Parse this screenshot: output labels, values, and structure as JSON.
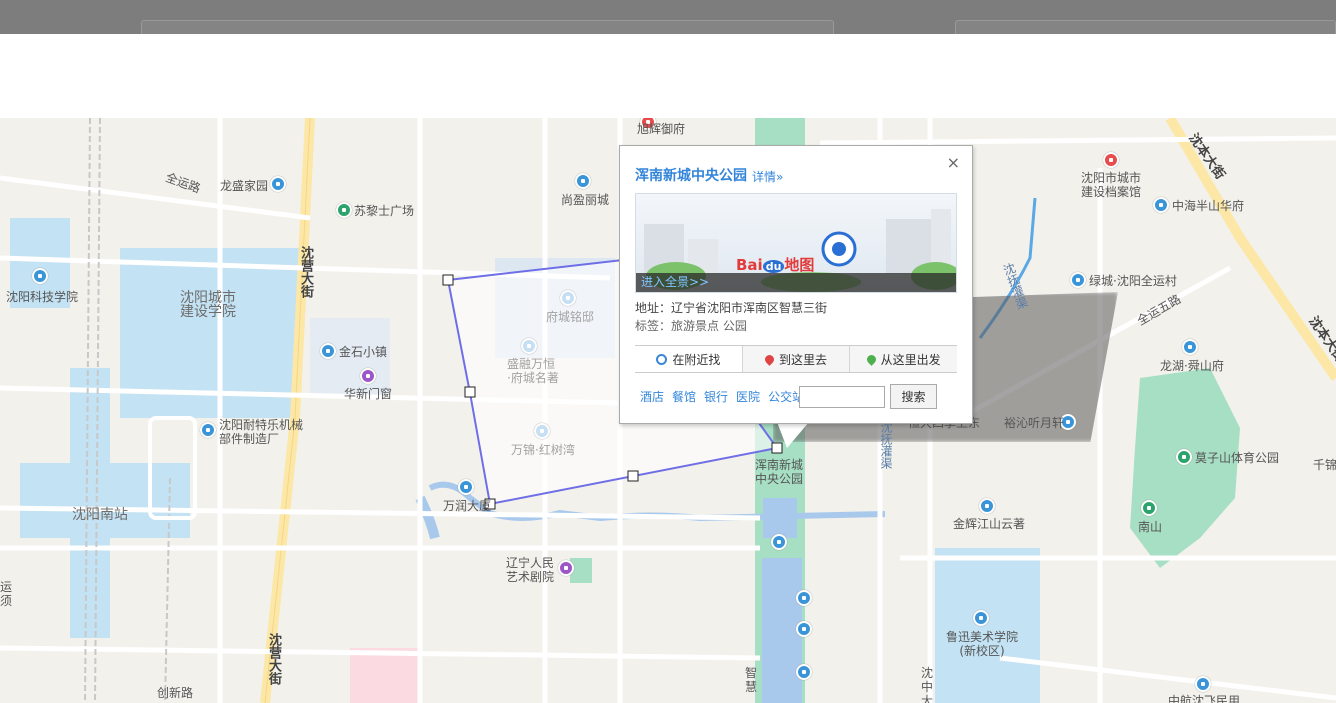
{
  "map": {
    "labels": {
      "quanyun": "全运路",
      "longsheng": "龙盛家园",
      "suli": "苏黎士广场",
      "shenying_top": "沈营大街",
      "shenying_bot": "沈营大街",
      "kejiyuan": "沈阳科技学院",
      "jianshe": "沈阳城市\n建设学院",
      "jinshi": "金石小镇",
      "huaxin": "华新门窗",
      "naitelai": "沈阳耐特乐机械\n部件制造厂",
      "nanzhan": "沈阳南站",
      "yunyu": "运\n须",
      "chuangxin": "创新路",
      "xuhui": "旭辉御府",
      "shangying": "尚盈丽城",
      "fuchengminglu": "府城铭邸",
      "shengrong": "盛融万恒\n·府城名著",
      "wanjin": "万锦·红树湾",
      "wanrun": "万润大厦",
      "liaoning_art": "辽宁人民\n艺术剧院",
      "hunnan_park": "浑南新城\n中央公园",
      "zhihui": "智\n慧",
      "chenzhong": "沈\n中\n大",
      "shenfu1": "沈抚灌渠",
      "shenfu2": "沈抚灌渠",
      "shenben1": "沈本大街",
      "shenben2": "沈本大街",
      "city_archive": "沈阳市城市\n建设档案馆",
      "zhonghai": "中海半山华府",
      "lvcheng": "绿城·沈阳全运村",
      "quanyun5": "全运五路",
      "longhu": "龙湖·舜山府",
      "mozi": "莫子山体育公园",
      "qianjin": "千锦",
      "yuqin": "裕沁听月轩",
      "hengda": "恒大四季上东",
      "nanshan": "南山",
      "jinhui": "金辉江山云著",
      "luxun": "鲁迅美术学院\n(新校区)",
      "zhonghang": "中航沈飞民用"
    }
  },
  "popup": {
    "close": "×",
    "title": "浑南新城中央公园",
    "detail": "详情»",
    "pano_brand": "Bai",
    "pano_brand_du": "du",
    "pano_brand_map": "地图",
    "pano_enter": "进入全景>>",
    "address": "地址：辽宁省沈阳市浑南区智慧三街",
    "tags": "标签：旅游景点 公园",
    "tabs": [
      "在附近找",
      "到这里去",
      "从这里出发"
    ],
    "nearby": [
      "酒店",
      "餐馆",
      "银行",
      "医院",
      "公交站"
    ],
    "search_value": "",
    "search_button": "搜索"
  },
  "colors": {
    "water": "#c3e2f3",
    "park": "#a7dfc4",
    "road_major": "#fce7a6",
    "polygon": "#6e6ee6",
    "accent": "#3385d9"
  }
}
